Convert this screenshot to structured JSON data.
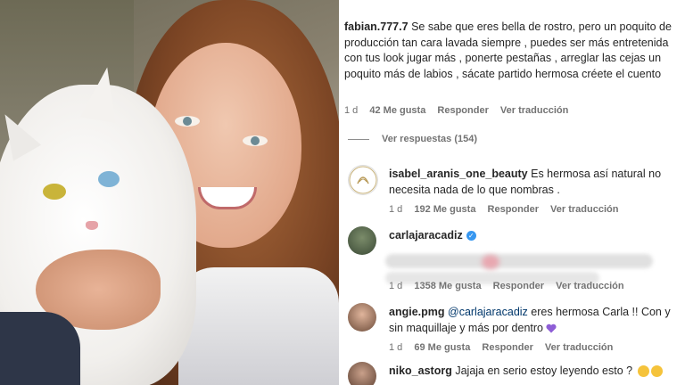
{
  "comments": [
    {
      "username": "fabian.777.7",
      "text": "Se sabe que eres bella de rostro, pero un poquito de producción tan cara lavada siempre , puedes ser más entretenida con tus look jugar más , ponerte pestañas , arreglar las cejas un poquito más de labios , sácate partido hermosa créete el cuento",
      "time": "1 d",
      "likes": "42 Me gusta",
      "reply": "Responder",
      "translate": "Ver traducción"
    },
    {
      "username": "isabel_aranis_one_beauty",
      "text": "Es hermosa así natural no necesita nada de lo que nombras .",
      "time": "1 d",
      "likes": "192 Me gusta",
      "reply": "Responder",
      "translate": "Ver traducción"
    },
    {
      "username": "carlajaracadiz",
      "time": "1 d",
      "likes": "1358 Me gusta",
      "reply": "Responder",
      "translate": "Ver traducción"
    },
    {
      "username": "angie.pmg",
      "mention": "@carlajaracadiz",
      "text": "eres hermosa Carla !! Con y sin maquillaje y más por dentro",
      "time": "1 d",
      "likes": "69 Me gusta",
      "reply": "Responder",
      "translate": "Ver traducción"
    },
    {
      "username": "niko_astorg",
      "text": "Jajaja en serio estoy leyendo esto ?"
    }
  ],
  "view_replies": "Ver respuestas (154)",
  "colors": {
    "text": "#262626",
    "meta": "#737373",
    "mention": "#00376b",
    "verified": "#3797f0"
  }
}
